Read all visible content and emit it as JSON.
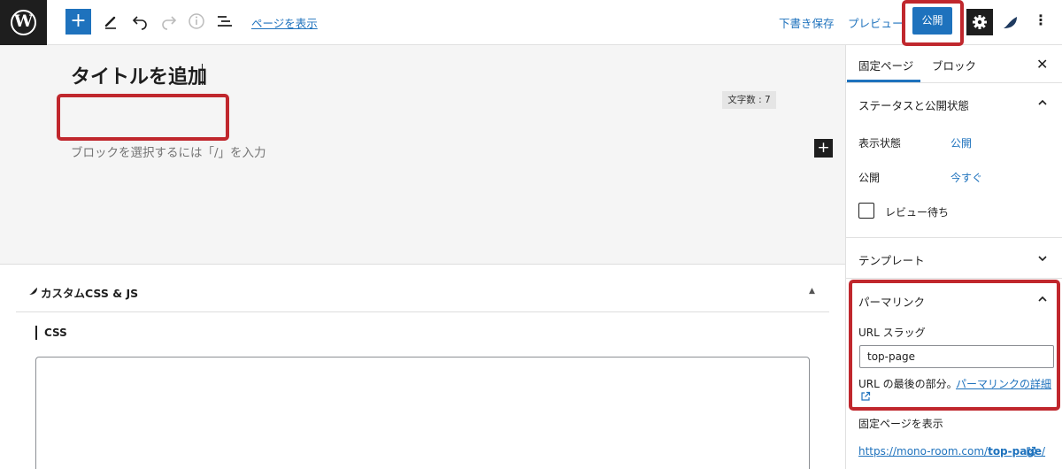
{
  "topbar": {
    "view_page_link": "ページを表示",
    "save_draft": "下書き保存",
    "preview": "プレビュー",
    "publish": "公開",
    "icons": [
      "wordpress-logo-icon",
      "plus-icon",
      "pencil-icon",
      "undo-icon",
      "redo-icon",
      "info-icon",
      "list-view-icon",
      "gear-icon",
      "plugin-icon",
      "more-vertical-icon"
    ]
  },
  "editor": {
    "title": "タイトルを追加",
    "word_count": "文字数 : 7",
    "block_placeholder": "ブロックを選択するには「/」を入力"
  },
  "metabox": {
    "title": "カスタムCSS & JS",
    "css_label": "CSS"
  },
  "sidebar": {
    "tabs": [
      {
        "label": "固定ページ",
        "active": true
      },
      {
        "label": "ブロック",
        "active": false
      }
    ],
    "status": {
      "heading": "ステータスと公開状態",
      "visibility_label": "表示状態",
      "visibility_value": "公開",
      "publish_label": "公開",
      "publish_value": "今すぐ",
      "pending_review": "レビュー待ち"
    },
    "template": {
      "heading": "テンプレート"
    },
    "permalink": {
      "heading": "パーマリンク",
      "slug_label": "URL スラッグ",
      "slug_value": "top-page",
      "help_text": "URL の最後の部分。",
      "help_link": "パーマリンクの詳細",
      "view_page_label": "固定ページを表示",
      "url_prefix": "https://mono-room.com/",
      "url_slug": "top-page",
      "url_suffix": "/"
    }
  },
  "colors": {
    "accent": "#1e72bd",
    "highlight": "#c0272d",
    "dark": "#1e1e1e"
  }
}
